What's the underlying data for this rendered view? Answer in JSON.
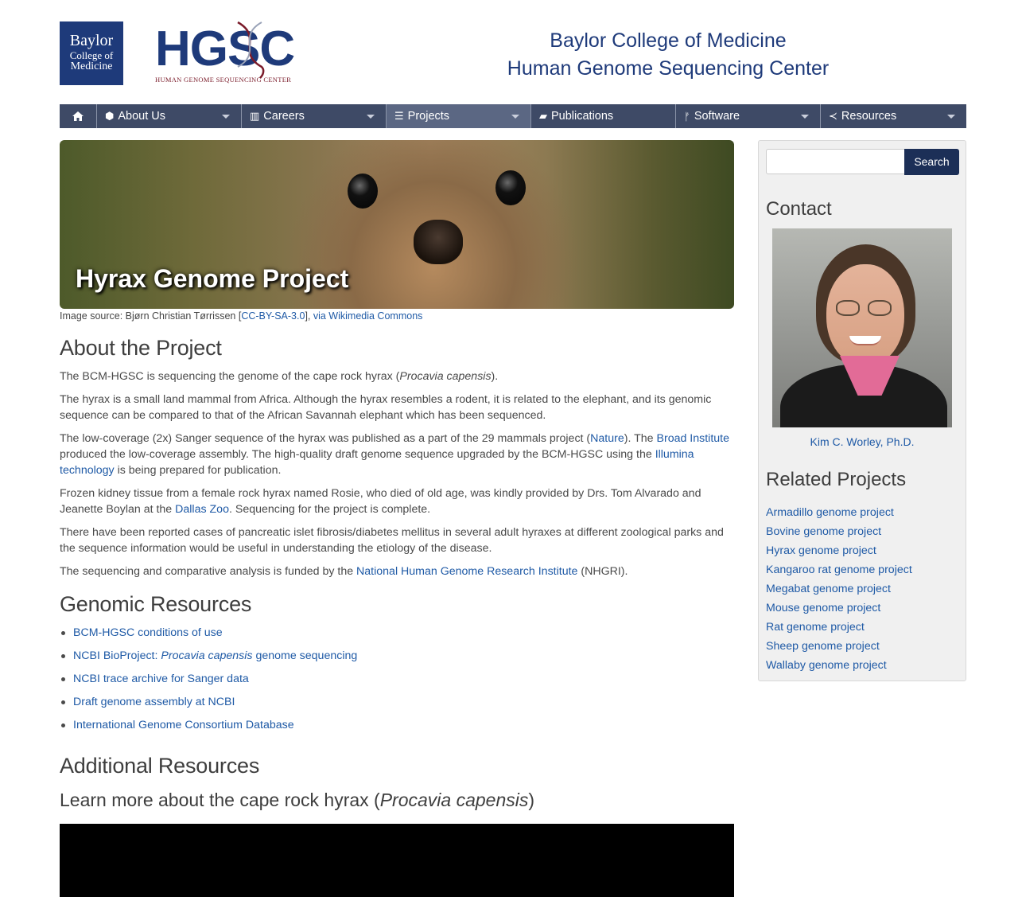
{
  "header": {
    "bcm_logo": {
      "line1": "Baylor",
      "line2": "College of",
      "line3": "Medicine"
    },
    "hgsc_logo": {
      "text": "HGSC",
      "subtitle": "HUMAN GENOME SEQUENCING CENTER"
    },
    "title_line1": "Baylor College of Medicine",
    "title_line2": "Human Genome Sequencing Center"
  },
  "nav": {
    "home_icon": "home-icon",
    "items": [
      {
        "label": "About Us",
        "icon": "cubes-icon"
      },
      {
        "label": "Careers",
        "icon": "building-icon"
      },
      {
        "label": "Projects",
        "icon": "database-icon",
        "active": true
      },
      {
        "label": "Publications",
        "icon": "book-icon"
      },
      {
        "label": "Software",
        "icon": "code-fork-icon"
      },
      {
        "label": "Resources",
        "icon": "share-icon"
      }
    ]
  },
  "banner": {
    "title": "Hyrax Genome Project",
    "source_prefix": "Image source: Bjørn Christian Tørrissen [",
    "source_license": "CC-BY-SA-3.0",
    "source_mid": "], ",
    "source_link": "via Wikimedia Commons"
  },
  "about": {
    "heading": "About the Project",
    "p1_a": "The BCM-HGSC is sequencing the genome of the cape rock hyrax (",
    "p1_i": "Procavia capensis",
    "p1_b": ").",
    "p2": "The hyrax is a small land mammal from Africa. Although the hyrax resembles a  rodent, it is related to the elephant, and its genomic sequence can be compared to that of the African Savannah elephant which has been sequenced.",
    "p3_a": "The low-coverage (2x) Sanger sequence of the hyrax was published as a part of the 29 mammals project (",
    "p3_link1": "Nature",
    "p3_b": "). The ",
    "p3_link2": "Broad Institute",
    "p3_c": " produced the low-coverage assembly. The high-quality draft genome sequence upgraded by the BCM-HGSC using the ",
    "p3_link3": "Illumina technology",
    "p3_d": " is being prepared for publication.",
    "p4_a": "Frozen kidney tissue from a female rock hyrax named Rosie, who died of old age, was kindly provided by Drs. Tom Alvarado and Jeanette Boylan at the ",
    "p4_link": "Dallas Zoo",
    "p4_b": ". Sequencing for the project is complete.",
    "p5": "There have been reported cases of pancreatic islet fibrosis/diabetes mellitus in several adult hyraxes at different zoological parks and the sequence information would be useful in understanding the etiology of the disease.",
    "p6_a": "The sequencing and comparative analysis is funded by the ",
    "p6_link": "National Human Genome Research Institute",
    "p6_b": " (NHGRI)."
  },
  "genomic": {
    "heading": "Genomic Resources",
    "items": [
      {
        "label": "BCM-HGSC conditions of use"
      },
      {
        "label_a": "NCBI BioProject: ",
        "label_i": "Procavia capensis",
        "label_b": " genome sequencing"
      },
      {
        "label": "NCBI trace archive for Sanger data"
      },
      {
        "label": "Draft genome assembly at NCBI"
      },
      {
        "label": "International Genome Consortium Database"
      }
    ]
  },
  "additional": {
    "heading": "Additional Resources",
    "sub_a": "Learn more about the cape rock hyrax (",
    "sub_i": "Procavia capensis",
    "sub_b": ")"
  },
  "sidebar": {
    "search_placeholder": "",
    "search_button": "Search",
    "contact_heading": "Contact",
    "contact_name": "Kim C. Worley, Ph.D.",
    "related_heading": "Related Projects",
    "related": [
      "Armadillo genome project",
      "Bovine genome project",
      "Hyrax genome project",
      "Kangaroo rat genome project",
      "Megabat genome project",
      "Mouse genome project",
      "Rat genome project",
      "Sheep genome project",
      "Wallaby genome project"
    ]
  },
  "colors": {
    "brand_navy": "#1e3a7a",
    "nav_bg": "#3e4a66",
    "link": "#1f5aa6",
    "logo_red": "#7a1b2a"
  }
}
